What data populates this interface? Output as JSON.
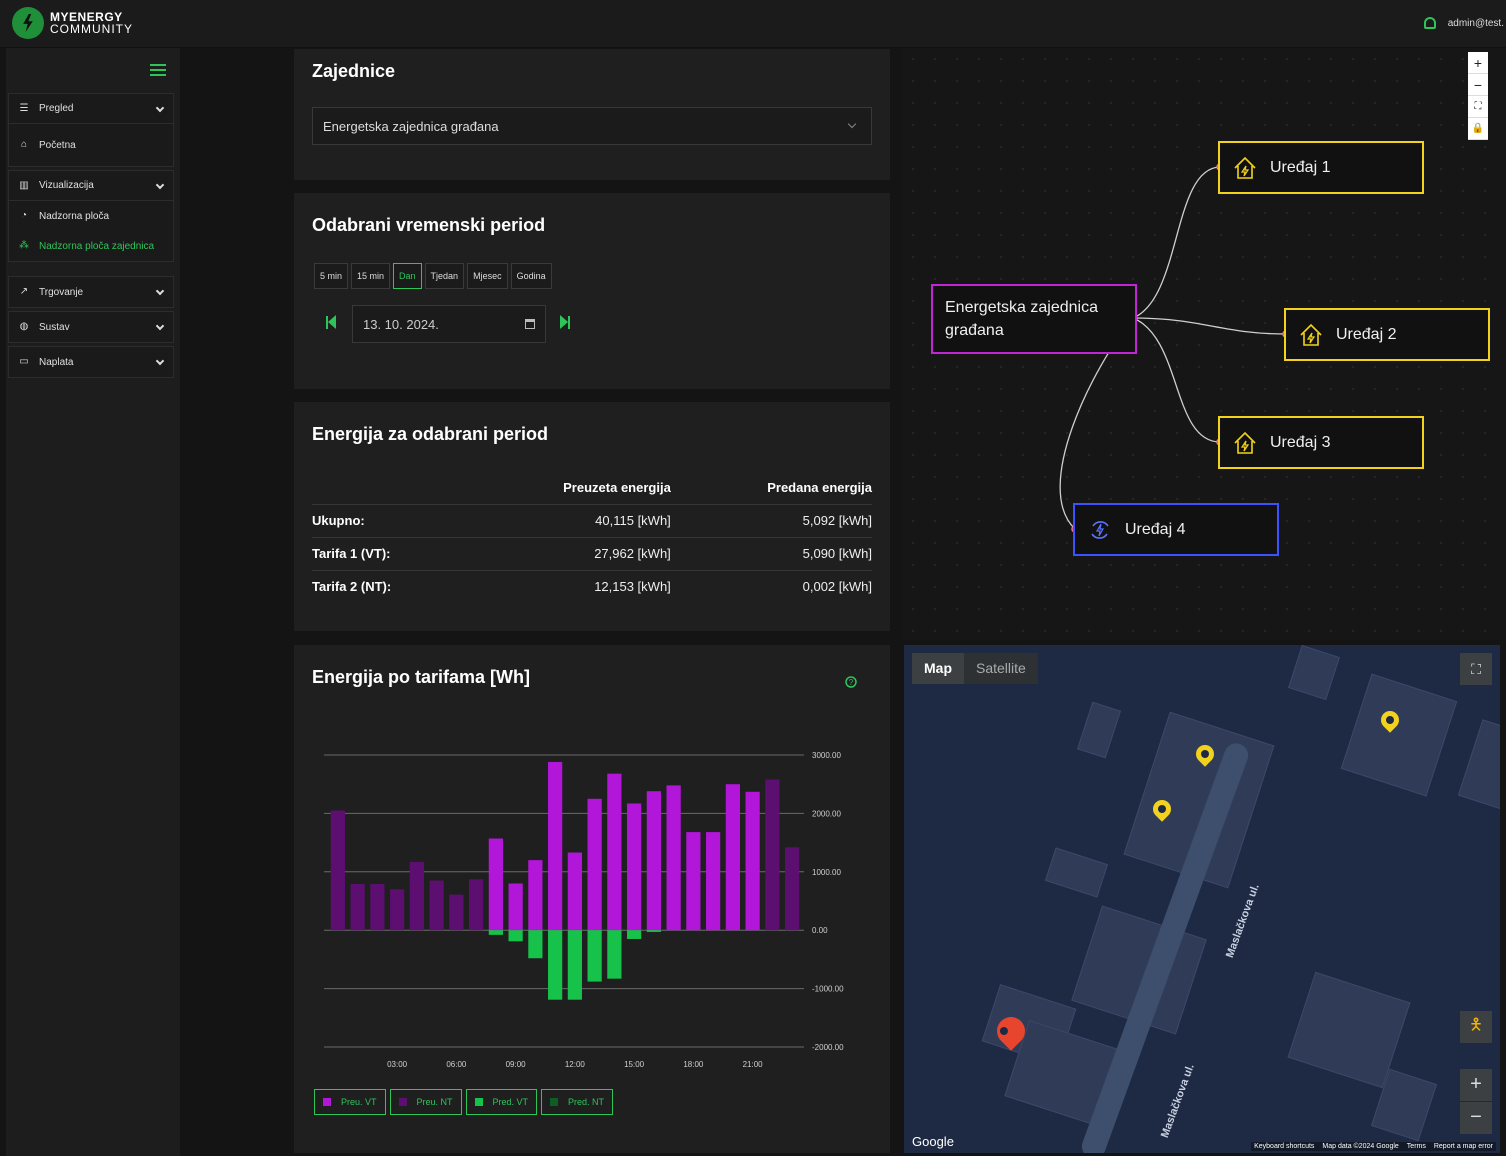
{
  "app": {
    "logo_line1": "MYENERGY",
    "logo_line2": "COMMUNITY",
    "user": "admin@test."
  },
  "sidebar": {
    "groups": [
      {
        "items": [
          {
            "label": "Pregled",
            "chev": true
          },
          {
            "label": "Početna"
          }
        ]
      },
      {
        "items": [
          {
            "label": "Vizualizacija",
            "chev": true
          },
          {
            "label": "Nadzorna ploča"
          },
          {
            "label": "Nadzorna ploča zajednica"
          }
        ]
      },
      {
        "items": [
          {
            "label": "Trgovanje",
            "chev": true
          }
        ]
      },
      {
        "items": [
          {
            "label": "Sustav",
            "chev": true
          }
        ]
      },
      {
        "items": [
          {
            "label": "Naplata",
            "chev": true
          }
        ]
      }
    ]
  },
  "communities": {
    "title": "Zajednice",
    "selected": "Energetska zajednica građana"
  },
  "period": {
    "title": "Odabrani vremenski period",
    "buttons": [
      "5 min",
      "15 min",
      "Dan",
      "Tjedan",
      "Mjesec",
      "Godina"
    ],
    "active": "Dan",
    "date": "13. 10. 2024."
  },
  "energy": {
    "title": "Energija za odabrani period",
    "headers": [
      "Preuzeta energija",
      "Predana energija"
    ],
    "rows": [
      {
        "label": "Ukupno:",
        "taken": "40,115 [kWh]",
        "given": "5,092 [kWh]"
      },
      {
        "label": "Tarifa 1 (VT):",
        "taken": "27,962 [kWh]",
        "given": "5,090 [kWh]"
      },
      {
        "label": "Tarifa 2 (NT):",
        "taken": "12,153 [kWh]",
        "given": "0,002 [kWh]"
      }
    ]
  },
  "graph": {
    "root": "Energetska zajednica građana",
    "devices": [
      "Uređaj 1",
      "Uređaj 2",
      "Uređaj 3",
      "Uređaj 4"
    ],
    "controls": [
      "+",
      "−",
      "⛶",
      "🔒"
    ]
  },
  "map": {
    "tab_map": "Map",
    "tab_satellite": "Satellite",
    "street": "Maslačkova ul.",
    "google": "Google",
    "footer": [
      "Keyboard shortcuts",
      "Map data ©2024 Google",
      "Terms",
      "Report a map error"
    ]
  },
  "chart_title": "Energija po tarifama [Wh]",
  "chart_data": {
    "type": "bar",
    "x": [
      "00:00",
      "01:00",
      "02:00",
      "03:00",
      "04:00",
      "05:00",
      "06:00",
      "07:00",
      "08:00",
      "09:00",
      "10:00",
      "11:00",
      "12:00",
      "13:00",
      "14:00",
      "15:00",
      "16:00",
      "17:00",
      "18:00",
      "19:00",
      "20:00",
      "21:00",
      "22:00",
      "23:00"
    ],
    "xticks": [
      "03:00",
      "06:00",
      "09:00",
      "12:00",
      "15:00",
      "18:00",
      "21:00"
    ],
    "yticks": [
      "3000.00",
      "2000.00",
      "1000.00",
      "0.00",
      "-1000.00",
      "-2000.00"
    ],
    "ylim": [
      -2000,
      3000
    ],
    "series": [
      {
        "name": "Preu. VT",
        "color": "#b216d8",
        "values": [
          0,
          0,
          0,
          0,
          0,
          0,
          0,
          0,
          1570,
          800,
          1200,
          2880,
          1330,
          2250,
          2680,
          2170,
          2380,
          2480,
          1680,
          1680,
          2500,
          2370,
          0,
          0
        ]
      },
      {
        "name": "Preu. NT",
        "color": "#5c0f70",
        "values": [
          2050,
          790,
          790,
          700,
          1170,
          850,
          610,
          870,
          0,
          0,
          0,
          0,
          0,
          0,
          0,
          0,
          0,
          0,
          0,
          0,
          0,
          0,
          2580,
          1420
        ]
      },
      {
        "name": "Pred. VT",
        "color": "#16c24a",
        "values": [
          0,
          0,
          0,
          0,
          0,
          0,
          0,
          0,
          -80,
          -190,
          -480,
          -1190,
          -1190,
          -880,
          -830,
          -150,
          -30,
          0,
          0,
          0,
          0,
          0,
          0,
          0
        ]
      },
      {
        "name": "Pred. NT",
        "color": "#0d5e25",
        "values": [
          0,
          0,
          0,
          0,
          0,
          0,
          0,
          0,
          0,
          0,
          0,
          0,
          0,
          0,
          0,
          0,
          0,
          0,
          0,
          0,
          0,
          0,
          0,
          0
        ]
      }
    ]
  },
  "colors": {
    "accent": "#2ec45a",
    "device": "#f2d21c",
    "root": "#c026d3",
    "device4": "#3b53ff"
  }
}
